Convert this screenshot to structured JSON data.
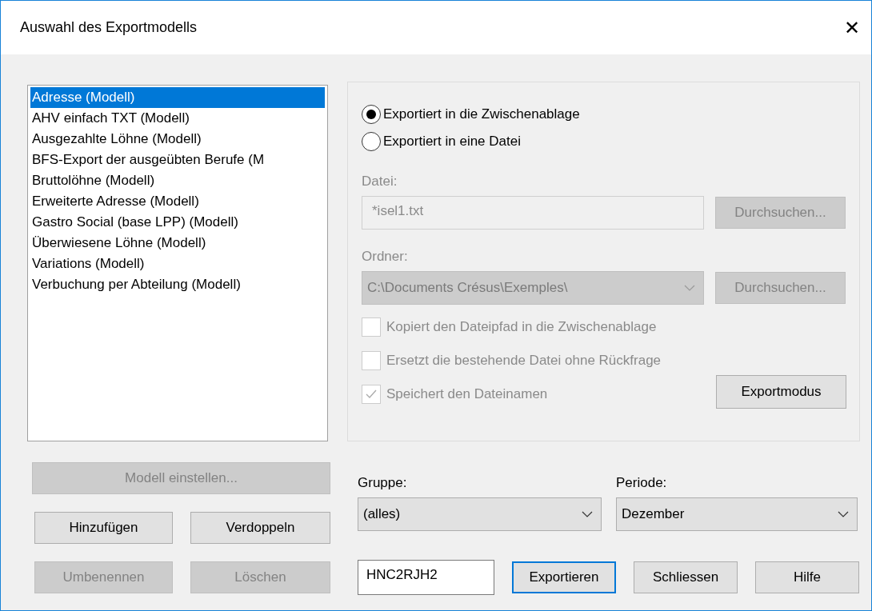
{
  "window": {
    "title": "Auswahl des Exportmodells",
    "close": "✕"
  },
  "model_list": [
    {
      "label": "Adresse (Modell)",
      "selected": true
    },
    {
      "label": "AHV einfach TXT (Modell)",
      "selected": false
    },
    {
      "label": "Ausgezahlte Löhne (Modell)",
      "selected": false
    },
    {
      "label": "BFS-Export der ausgeübten Berufe (M",
      "selected": false
    },
    {
      "label": "Bruttolöhne (Modell)",
      "selected": false
    },
    {
      "label": "Erweiterte Adresse (Modell)",
      "selected": false
    },
    {
      "label": "Gastro Social (base LPP) (Modell)",
      "selected": false
    },
    {
      "label": "Überwiesene Löhne (Modell)",
      "selected": false
    },
    {
      "label": "Variations (Modell)",
      "selected": false
    },
    {
      "label": "Verbuchung per Abteilung (Modell)",
      "selected": false
    }
  ],
  "export_target": [
    {
      "label": "Exportiert in die Zwischenablage",
      "selected": true
    },
    {
      "label": "Exportiert in eine Datei",
      "selected": false
    }
  ],
  "file": {
    "label": "Datei:",
    "value": "*isel1.txt",
    "browse": "Durchsuchen...",
    "disabled": true
  },
  "folder": {
    "label": "Ordner:",
    "value": "C:\\Documents Crésus\\Exemples\\",
    "browse": "Durchsuchen...",
    "disabled": true
  },
  "options": [
    {
      "label": "Kopiert den Dateipfad in die Zwischenablage",
      "checked": false,
      "disabled": true
    },
    {
      "label": "Ersetzt die bestehende Datei ohne Rückfrage",
      "checked": false,
      "disabled": true
    },
    {
      "label": "Speichert den Dateinamen",
      "checked": true,
      "disabled": true
    }
  ],
  "export_mode_button": {
    "label": "Exportmodus"
  },
  "model_buttons": [
    {
      "label": "Modell einstellen...",
      "disabled": true
    },
    {
      "label": "Hinzufügen",
      "disabled": false
    },
    {
      "label": "Verdoppeln",
      "disabled": false
    },
    {
      "label": "Umbenennen",
      "disabled": true
    },
    {
      "label": "Löschen",
      "disabled": true
    }
  ],
  "group": {
    "label": "Gruppe:",
    "value": "(alles)"
  },
  "period": {
    "label": "Periode:",
    "value": "Dezember"
  },
  "code_field": {
    "value": "HNC2RJH2"
  },
  "buttons": [
    {
      "label": "Exportieren",
      "focused": true
    },
    {
      "label": "Schliessen",
      "focused": false
    },
    {
      "label": "Hilfe",
      "focused": false
    }
  ]
}
